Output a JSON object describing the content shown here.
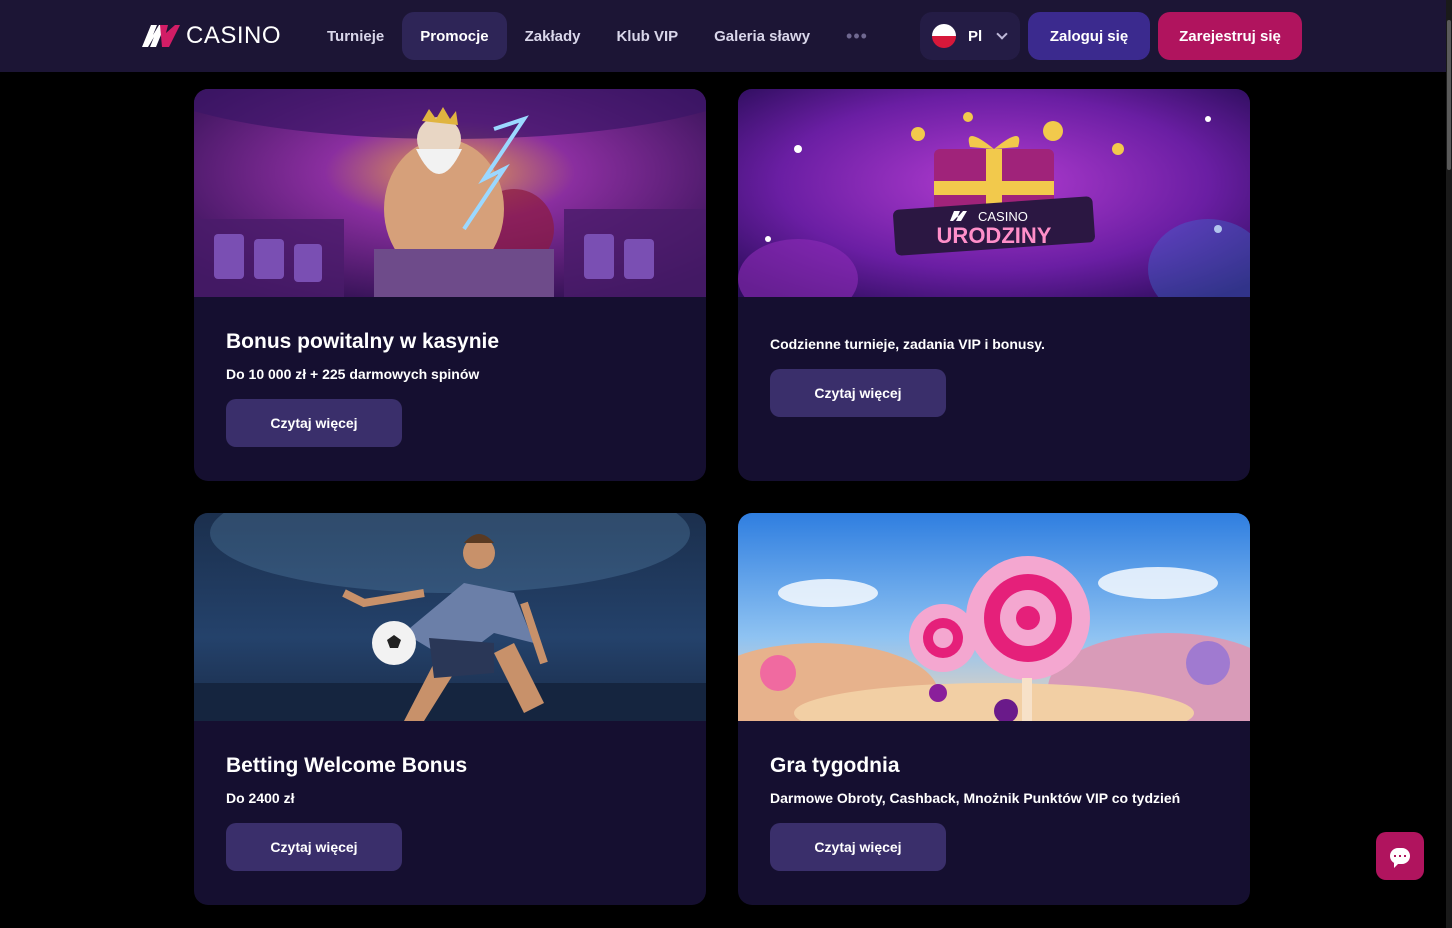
{
  "brand": {
    "name": "CASINO"
  },
  "nav": {
    "items": [
      {
        "label": "Turnieje",
        "active": false
      },
      {
        "label": "Promocje",
        "active": true
      },
      {
        "label": "Zakłady",
        "active": false
      },
      {
        "label": "Klub VIP",
        "active": false
      },
      {
        "label": "Galeria sławy",
        "active": false
      }
    ],
    "more": "•••"
  },
  "language": {
    "code": "Pl"
  },
  "auth": {
    "login": "Zaloguj się",
    "register": "Zarejestruj się"
  },
  "cards": [
    {
      "title": "Bonus powitalny w kasynie",
      "subtitle": "Do 10 000 zł + 225 darmowych spinów",
      "button": "Czytaj więcej",
      "image": "zeus-casino"
    },
    {
      "title": "",
      "subtitle": "Codzienne turnieje, zadania VIP i bonusy.",
      "button": "Czytaj więcej",
      "image": "birthday-gift",
      "image_text": {
        "brand": "CASINO",
        "headline": "URODZINY"
      }
    },
    {
      "title": "Betting Welcome Bonus",
      "subtitle": "Do 2400 zł",
      "button": "Czytaj więcej",
      "image": "football-player"
    },
    {
      "title": "Gra tygodnia",
      "subtitle": "Darmowe Obroty, Cashback, Mnożnik Punktów VIP co tydzień",
      "button": "Czytaj więcej",
      "image": "candy-lollipop"
    }
  ],
  "colors": {
    "header_bg": "#1c1535",
    "card_bg": "#150f30",
    "register": "#b0145e",
    "login": "#3b2a8e"
  }
}
